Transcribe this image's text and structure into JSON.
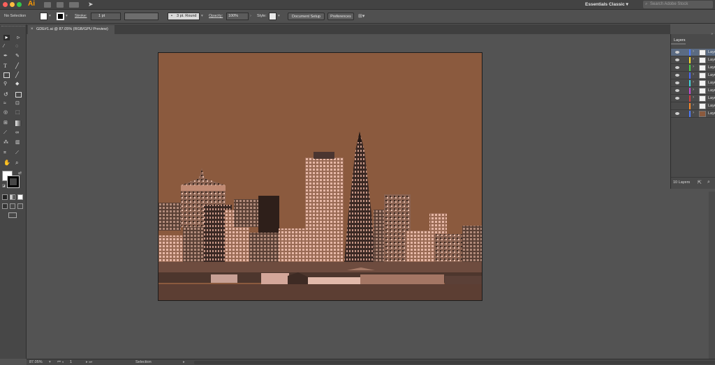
{
  "app": {
    "logo": "Ai",
    "workspace": "Essentials Classic",
    "stock_search_placeholder": "Search Adobe Stock"
  },
  "control_bar": {
    "selection": "No Selection",
    "stroke_label": "Stroke:",
    "stroke_value": "1 pt",
    "brush": "3 pt. Round",
    "opacity_label": "Opacity:",
    "opacity_value": "100%",
    "style_label": "Style:",
    "document_setup": "Document Setup",
    "preferences": "Preferences"
  },
  "document": {
    "tab_title": "GDE#1.ai @ 87.05% (RGB/GPU Preview)"
  },
  "layers_panel": {
    "title": "Layers",
    "footer": "10 Layers",
    "layers": [
      {
        "name": "Layer",
        "color": "#4d7cff",
        "visible": true
      },
      {
        "name": "Layer",
        "color": "#ffdc2a",
        "visible": true
      },
      {
        "name": "Layer",
        "color": "#49d34b",
        "visible": true
      },
      {
        "name": "Layer",
        "color": "#4a6bff",
        "visible": true
      },
      {
        "name": "Layer",
        "color": "#41d8e0",
        "visible": true
      },
      {
        "name": "Layer",
        "color": "#c44ad8",
        "visible": true
      },
      {
        "name": "Layer",
        "color": "#d33f3f",
        "visible": true
      },
      {
        "name": "Layer",
        "color": "#ff8c2a",
        "visible": false
      },
      {
        "name": "Layer",
        "color": "#4d7cff",
        "visible": true
      }
    ]
  },
  "status_bar": {
    "zoom": "87.05%",
    "artboard": "1",
    "tool": "Selection"
  },
  "colors": {
    "artboard_bg": "#8b5a3e",
    "app_bg": "#535353",
    "accent": "#ff9a00"
  }
}
